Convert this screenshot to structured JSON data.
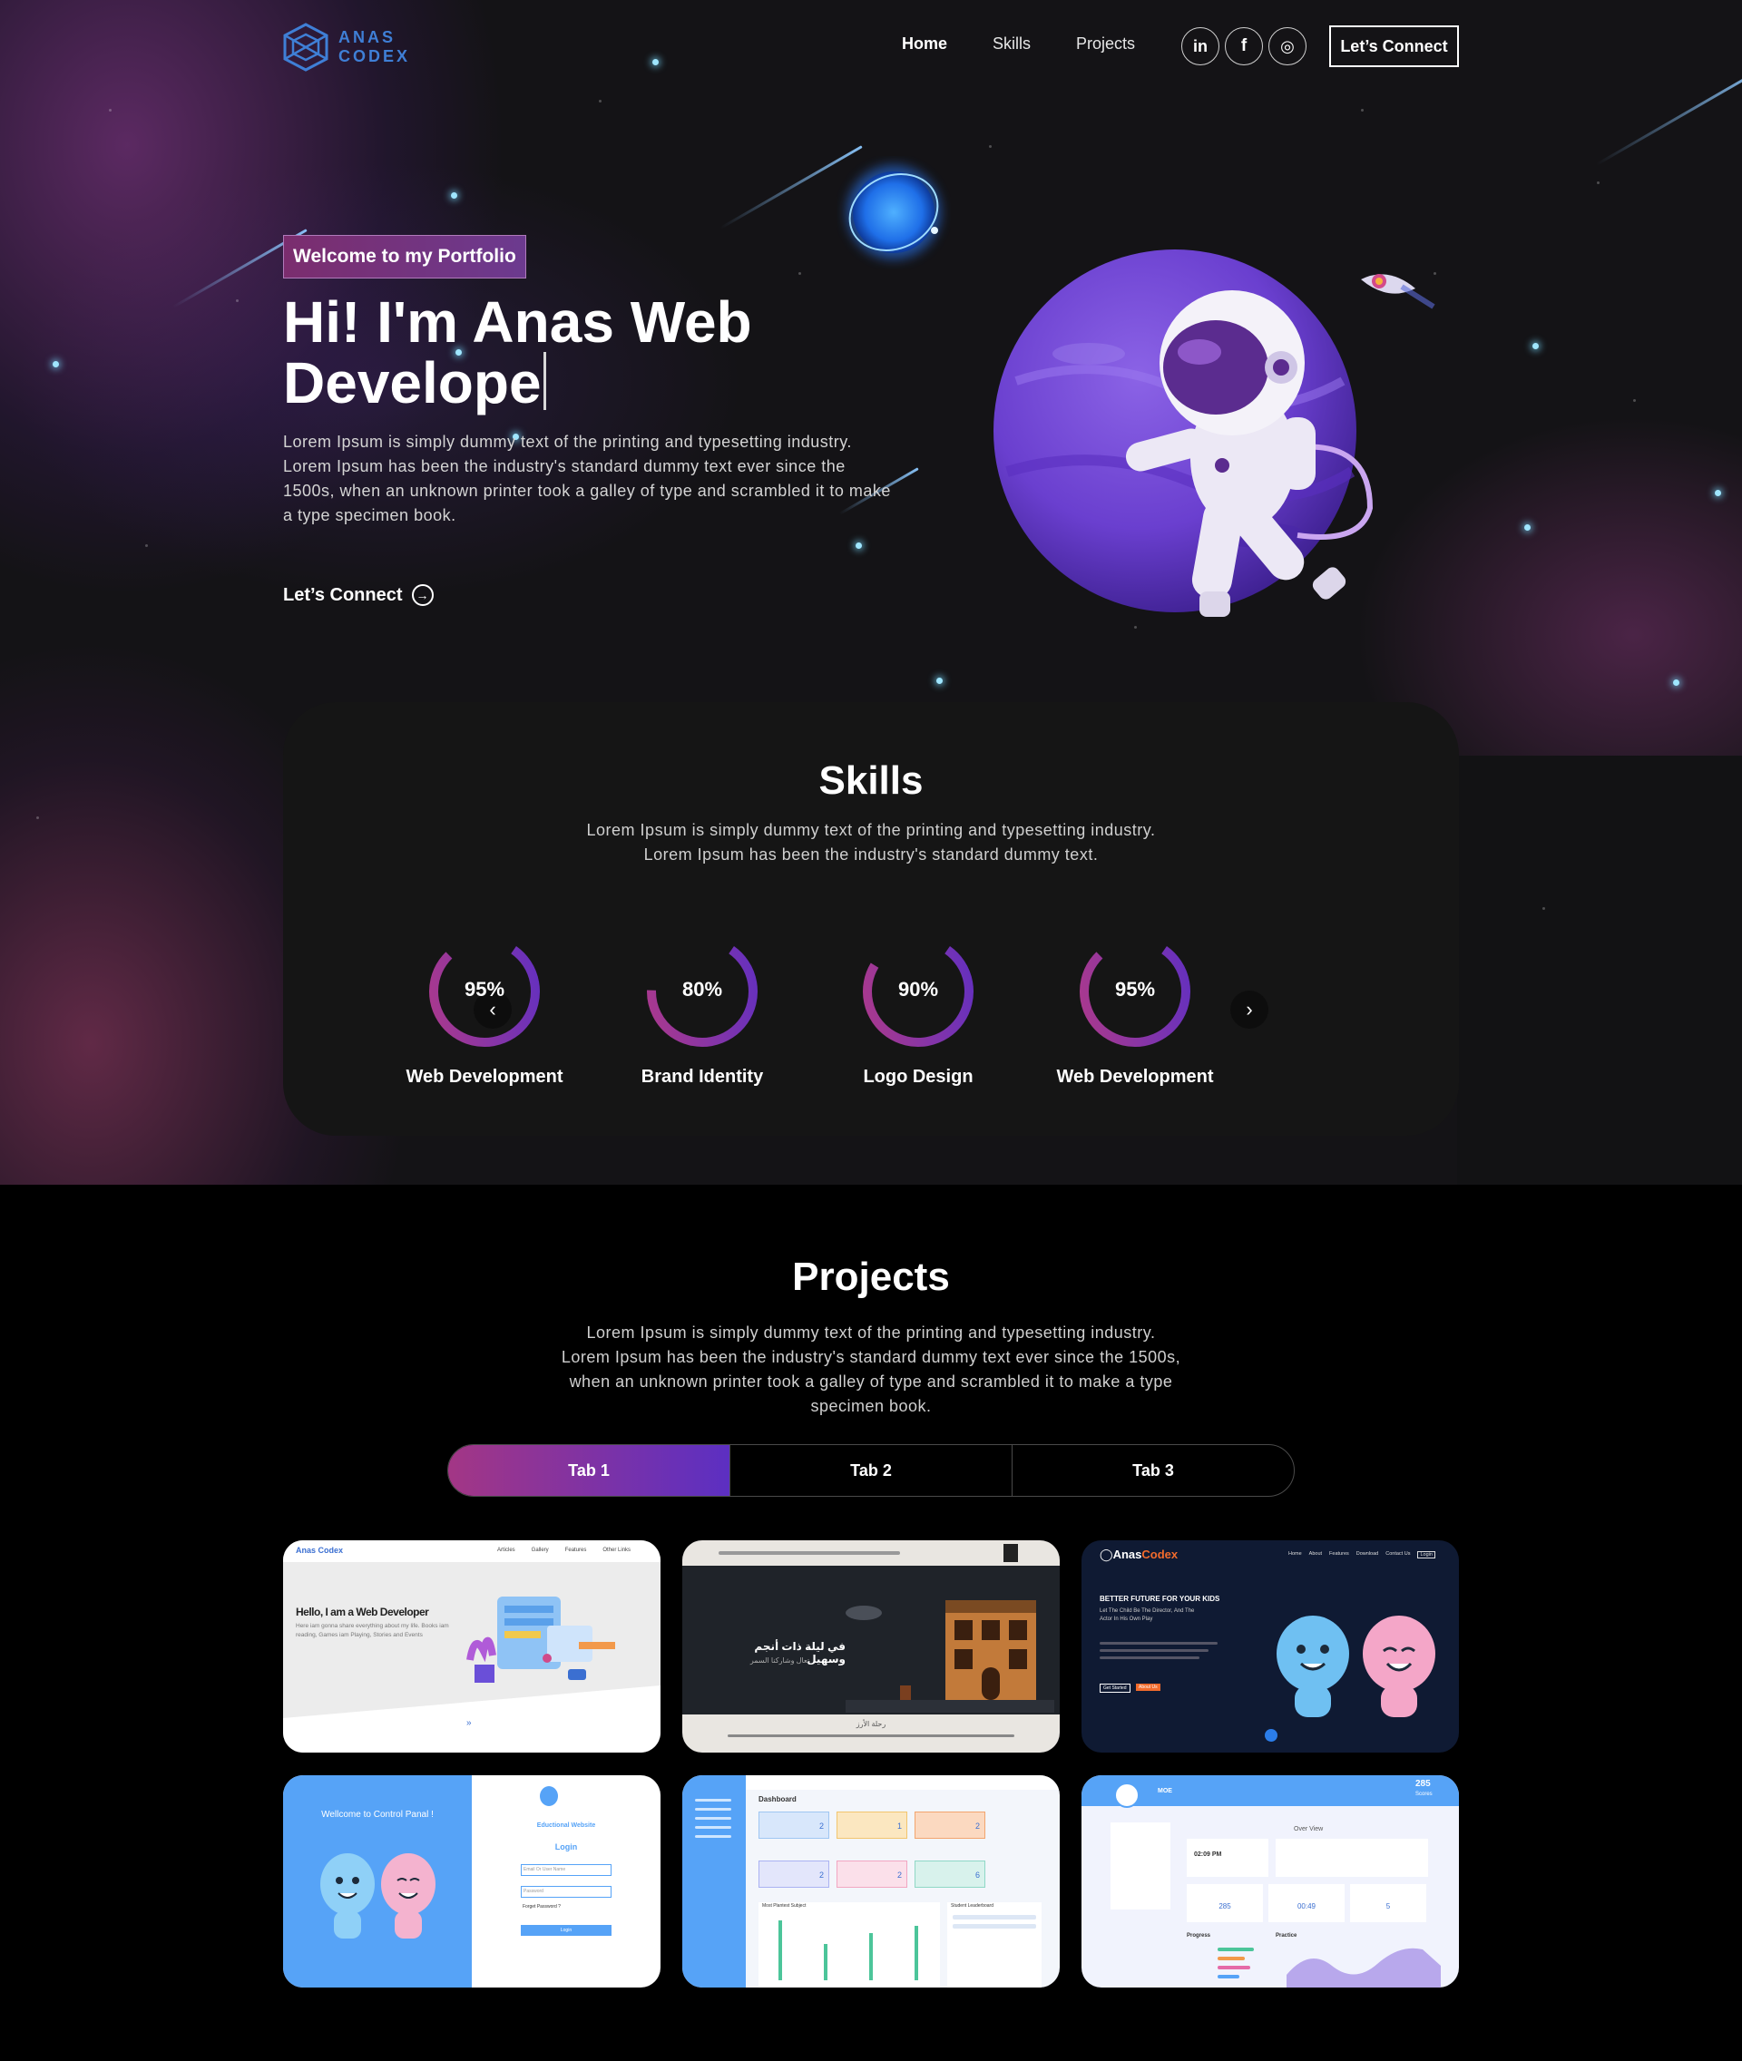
{
  "nav": {
    "logo_line1": "ANAS",
    "logo_line2": "CODEX",
    "links": [
      "Home",
      "Skills",
      "Projects"
    ],
    "social": [
      "linkedin-icon",
      "facebook-icon",
      "instagram-icon"
    ],
    "social_glyphs": [
      "in",
      "f",
      "◎"
    ],
    "connect_label": "Let’s Connect"
  },
  "hero": {
    "tagline": "Welcome to my Portfolio",
    "title_line1": "Hi! I'm Anas Web",
    "title_line2": "Develope",
    "description": "Lorem Ipsum is simply dummy text of the printing and typesetting industry. Lorem Ipsum has been the industry's standard dummy text ever since the 1500s, when an unknown printer took a galley of type and scrambled it to make a type specimen book.",
    "cta_label": "Let’s Connect",
    "cta_icon": "arrow-circle-icon"
  },
  "skills": {
    "title": "Skills",
    "description_line1": "Lorem Ipsum is simply dummy text of the printing and typesetting industry.",
    "description_line2": "Lorem Ipsum has been the industry's standard dummy text.",
    "items": [
      {
        "label": "Web Development",
        "percent": 95,
        "percent_text": "95%"
      },
      {
        "label": "Brand Identity",
        "percent": 80,
        "percent_text": "80%"
      },
      {
        "label": "Logo Design",
        "percent": 90,
        "percent_text": "90%"
      },
      {
        "label": "Web Development",
        "percent": 95,
        "percent_text": "95%"
      }
    ],
    "prev_icon": "chevron-left-icon",
    "next_icon": "chevron-right-icon"
  },
  "projects": {
    "title": "Projects",
    "description_line1": "Lorem Ipsum is simply dummy text of the printing and typesetting industry.",
    "description_line2": "Lorem Ipsum has been the industry's standard dummy text ever since the 1500s,",
    "description_line3": "when an unknown printer took a galley of type and scrambled it to make a type",
    "description_line4": "specimen book.",
    "tabs": [
      "Tab 1",
      "Tab 2",
      "Tab 3"
    ],
    "active_tab": "Tab 1",
    "thumbs": {
      "t1_brand": "Anas Codex",
      "t1_nav": [
        "Articles",
        "Gallery",
        "Features",
        "Other Links"
      ],
      "t1_heading": "Hello, I am a Web Developer",
      "t1_text": "Here iam gonna share everything about my life. Books iam reading, Games iam Playing, Stories and Events",
      "t2_heading": "في ليلة ذات أنجم وسهيل",
      "t2_sub": "تعال وشاركنا السمر",
      "t2_footer": "رحلة الأرز",
      "t3_brand_a": "Anas",
      "t3_brand_b": "Codex",
      "t3_nav": [
        "Home",
        "About",
        "Features",
        "Download",
        "Contact Us",
        "Login"
      ],
      "t3_heading": "BETTER FUTURE FOR YOUR KIDS",
      "t3_sub": "Let The Child Be The Director, And The Actor In His Own Play",
      "t3_btn1": "Get Started",
      "t3_btn2": "About Us",
      "t4_welcome": "Wellcome to Control Panal !",
      "t4_site": "Eductional Website",
      "t4_login": "Login",
      "t4_field1": "Email Or User Name",
      "t4_field2": "Password",
      "t4_forgot": "Forget Password ?",
      "t4_btn": "Login",
      "t5_title": "Dashboard",
      "t5_counts": [
        "2",
        "1",
        "2",
        "2",
        "2",
        "6"
      ],
      "t5_chart_label": "Most Plantest Subject",
      "t5_board_label": "Student Leaderboard",
      "t6_name": "MOE",
      "t6_score": "285",
      "t6_score_label": "Scores",
      "t6_overview": "Over View",
      "t6_time": "02:09 PM",
      "t6_stat1": "285",
      "t6_stat2": "00:49",
      "t6_stat3": "5",
      "t6_progress": "Progress",
      "t6_practice": "Practice"
    }
  },
  "colors": {
    "accent_pink": "#a33685",
    "accent_purple": "#5c2fc2",
    "page_bg": "#000000",
    "card_bg": "#151515"
  }
}
